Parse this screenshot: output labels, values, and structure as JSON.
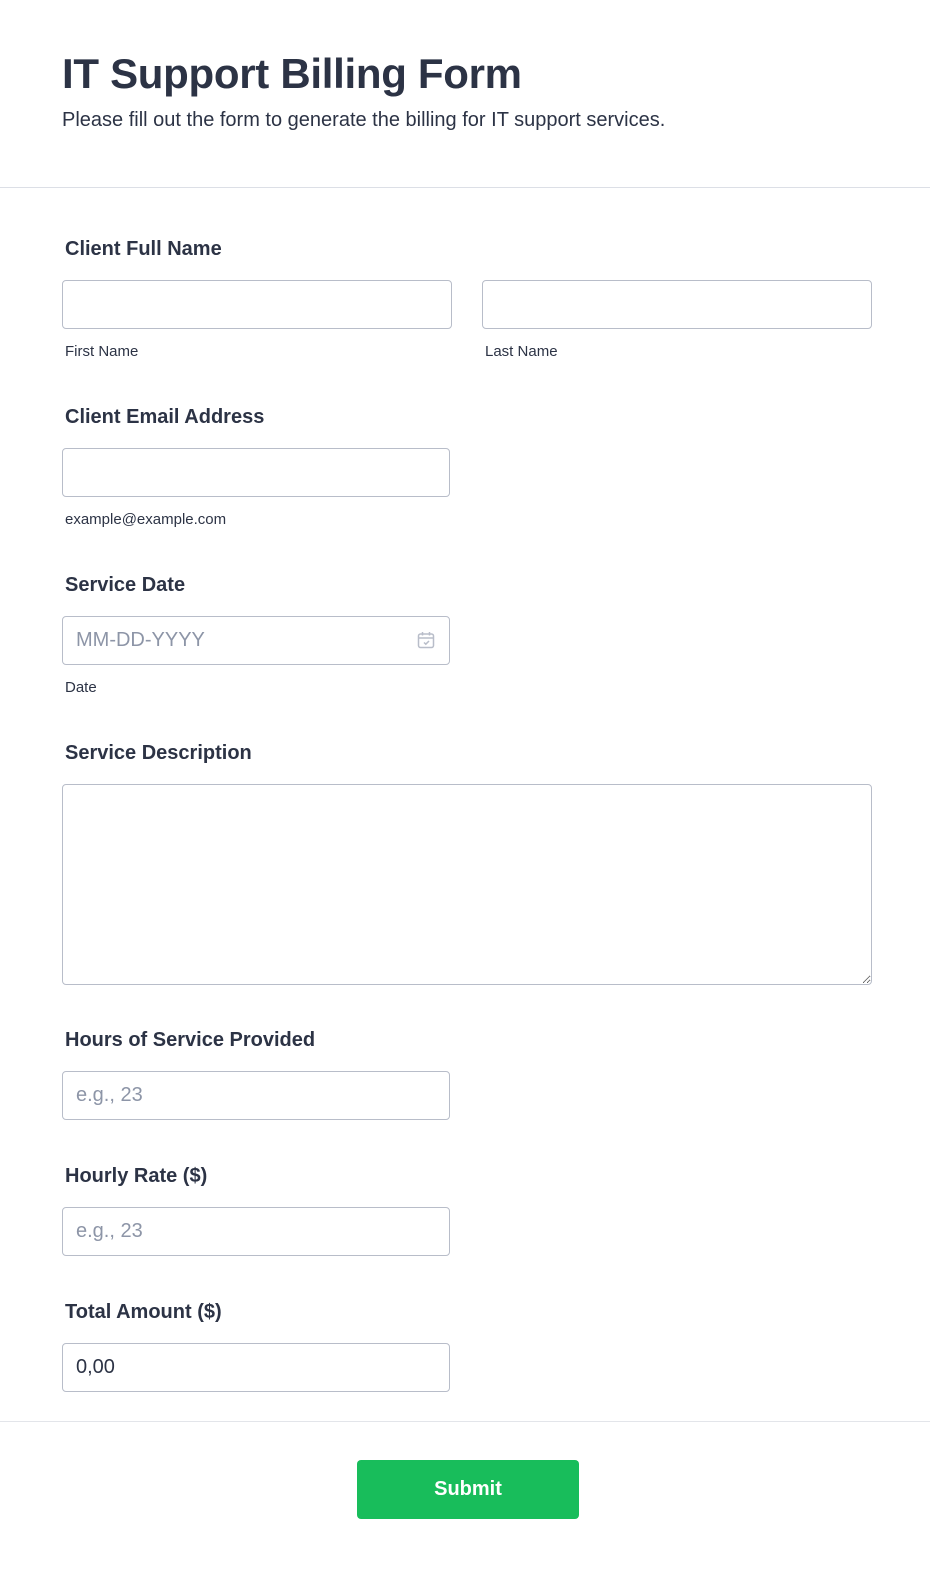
{
  "header": {
    "title": "IT Support Billing Form",
    "subtitle": "Please fill out the form to generate the billing for IT support services."
  },
  "client_name": {
    "label": "Client Full Name",
    "first": {
      "value": "",
      "sublabel": "First Name"
    },
    "last": {
      "value": "",
      "sublabel": "Last Name"
    }
  },
  "client_email": {
    "label": "Client Email Address",
    "value": "",
    "sublabel": "example@example.com"
  },
  "service_date": {
    "label": "Service Date",
    "value": "",
    "placeholder": "MM-DD-YYYY",
    "sublabel": "Date",
    "icon": "calendar-icon"
  },
  "service_description": {
    "label": "Service Description",
    "value": ""
  },
  "hours": {
    "label": "Hours of Service Provided",
    "value": "",
    "placeholder": "e.g., 23"
  },
  "hourly_rate": {
    "label": "Hourly Rate ($)",
    "value": "",
    "placeholder": "e.g., 23"
  },
  "total_amount": {
    "label": "Total Amount ($)",
    "value": "0,00"
  },
  "submit": {
    "label": "Submit",
    "color": "#18bd5b"
  }
}
